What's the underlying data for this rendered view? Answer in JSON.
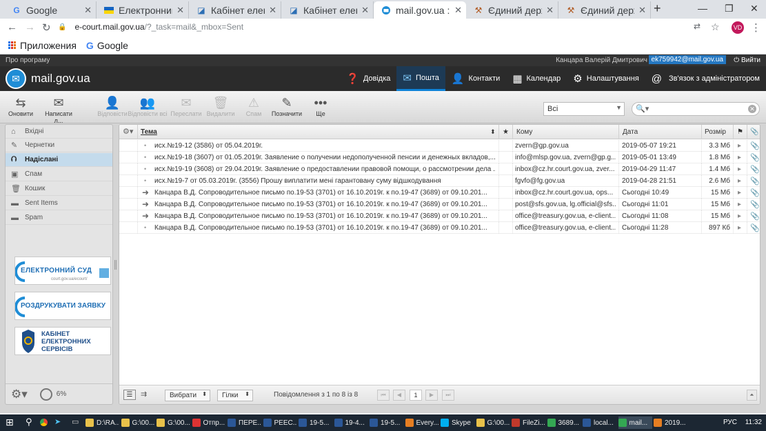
{
  "browser": {
    "tabs": [
      {
        "label": "Google",
        "favicon": "G",
        "color": "#4285f4"
      },
      {
        "label": "Електронний",
        "favicon": "flag",
        "color": "#ffd500"
      },
      {
        "label": "Кабінет елект",
        "favicon": "K",
        "color": "#2c6fb5"
      },
      {
        "label": "Кабінет елект",
        "favicon": "K",
        "color": "#2c6fb5"
      },
      {
        "label": "mail.gov.ua ::",
        "favicon": "@",
        "color": "#1f8dd6"
      },
      {
        "label": "Єдиний держ",
        "favicon": "hammer",
        "color": "#b05a22"
      },
      {
        "label": "Єдиний держ",
        "favicon": "hammer",
        "color": "#b05a22"
      }
    ],
    "url_host": "e-court.mail.gov.ua",
    "url_path": "/?_task=mail&_mbox=Sent",
    "profile_initials": "VD",
    "bookmarks": [
      {
        "label": "Приложения"
      },
      {
        "label": "Google"
      }
    ]
  },
  "app": {
    "about": "Про програму",
    "user_name": "Канцара Валерій Дмитрович",
    "user_email": "ek759942@mail.gov.ua",
    "logout": "Вийти",
    "logo_text": "mail.gov.ua",
    "nav": [
      {
        "label": "Довідка",
        "icon": "help-icon"
      },
      {
        "label": "Пошта",
        "icon": "mail-icon",
        "active": true
      },
      {
        "label": "Контакти",
        "icon": "contacts-icon"
      },
      {
        "label": "Календар",
        "icon": "calendar-icon"
      },
      {
        "label": "Налаштування",
        "icon": "gear-icon"
      },
      {
        "label": "Зв'язок з адміністратором",
        "icon": "at-icon"
      }
    ]
  },
  "toolbar": {
    "buttons": [
      {
        "label": "Оновити",
        "icon": "refresh-icon",
        "enabled": true
      },
      {
        "label": "Написати л...",
        "icon": "compose-icon",
        "enabled": true
      },
      {
        "label": "Відповісти",
        "icon": "reply-icon",
        "enabled": false
      },
      {
        "label": "Відповісти всі",
        "icon": "reply-all-icon",
        "enabled": false
      },
      {
        "label": "Переслати",
        "icon": "forward-icon",
        "enabled": false
      },
      {
        "label": "Видалити",
        "icon": "trash-icon",
        "enabled": false
      },
      {
        "label": "Спам",
        "icon": "spam-icon",
        "enabled": false
      },
      {
        "label": "Позначити",
        "icon": "mark-icon",
        "enabled": true
      },
      {
        "label": "Ще",
        "icon": "more-icon",
        "enabled": true
      }
    ],
    "filter_value": "Всі",
    "search_value": ""
  },
  "folders": [
    {
      "label": "Вхідні",
      "icon": "inbox-icon"
    },
    {
      "label": "Чернетки",
      "icon": "drafts-icon"
    },
    {
      "label": "Надіслані",
      "icon": "sent-icon",
      "selected": true
    },
    {
      "label": "Спам",
      "icon": "spam-icon"
    },
    {
      "label": "Кошик",
      "icon": "trash-icon"
    },
    {
      "label": "Sent Items",
      "icon": "folder-icon"
    },
    {
      "label": "Spam",
      "icon": "folder-icon"
    }
  ],
  "banners": [
    {
      "title": "ЕЛЕКТРОННИЙ СУД",
      "subtitle": "court.gov.ua/ecourt/"
    },
    {
      "title": "РОЗДРУКУВАТИ ЗАЯВКУ"
    },
    {
      "title": "КАБІНЕТ ЕЛЕКТРОННИХ СЕРВІСІВ"
    }
  ],
  "quota": "6%",
  "list": {
    "headers": {
      "subject": "Тема",
      "to": "Кому",
      "date": "Дата",
      "size": "Розмір"
    },
    "rows": [
      {
        "subject": "исх.№19-12 (3586) от 05.04.2019г.",
        "to": "zvern@gp.gov.ua",
        "date": "2019-05-07 19:21",
        "size": "3.3 Мб",
        "forwarded": false
      },
      {
        "subject": "исх.№19-18 (3607) от 01.05.2019г. Заявление о получении недополученной пенсии и денежных вкладов,...",
        "to": "info@mlsp.gov.ua, zvern@gp.g...",
        "date": "2019-05-01 13:49",
        "size": "1.8 Мб",
        "forwarded": false
      },
      {
        "subject": "исх.№19-19 (3608) от 29.04.2019г. Заявление о предоставлении правовой помощи, о рассмотрении дела ...",
        "to": "inbox@cz.hr.court.gov.ua, zver...",
        "date": "2019-04-29 11:47",
        "size": "1.4 Мб",
        "forwarded": false
      },
      {
        "subject": "исх.№19-7 от 05.03.2019г. (3556) Прошу виплатити мені гарантовану суму відшкодування",
        "to": "fgvfo@fg.gov.ua",
        "date": "2019-04-28 21:51",
        "size": "2.6 Мб",
        "forwarded": false
      },
      {
        "subject": "Канцара В.Д. Сопроводительное письмо по.19-53 (3701) от 16.10.2019г. к по.19-47 (3689) от 09.10.201...",
        "to": "inbox@cz.hr.court.gov.ua, ops...",
        "date": "Сьогодні 10:49",
        "size": "15 Мб",
        "forwarded": true
      },
      {
        "subject": "Канцара В.Д. Сопроводительное письмо по.19-53 (3701) от 16.10.2019г. к по.19-47 (3689) от 09.10.201...",
        "to": "post@sfs.gov.ua, lg.official@sfs...",
        "date": "Сьогодні 11:01",
        "size": "15 Мб",
        "forwarded": true
      },
      {
        "subject": "Канцара В.Д. Сопроводительное письмо по.19-53 (3701) от 16.10.2019г. к по.19-47 (3689) от 09.10.201...",
        "to": "office@treasury.gov.ua, e-client...",
        "date": "Сьогодні 11:08",
        "size": "15 Мб",
        "forwarded": true
      },
      {
        "subject": "Канцара В.Д. Сопроводительное письмо по.19-53 (3701) от 16.10.2019г. к по.19-47 (3689) от 09.10.201...",
        "to": "office@treasury.gov.ua, e-client...",
        "date": "Сьогодні 11:28",
        "size": "897 Кб",
        "forwarded": false
      }
    ],
    "footer": {
      "select_label": "Вибрати",
      "threads_label": "Гілки",
      "count_text": "Повідомлення з 1 по 8 із 8",
      "page": "1"
    }
  },
  "taskbar": {
    "items": [
      {
        "label": "D:\\RA...",
        "color": "#e8c14a"
      },
      {
        "label": "G:\\00...",
        "color": "#e8c14a"
      },
      {
        "label": "G:\\00...",
        "color": "#e8c14a"
      },
      {
        "label": "Отпр...",
        "color": "#d33"
      },
      {
        "label": "ПЕРЕ...",
        "color": "#2b5797"
      },
      {
        "label": "РЕЕС...",
        "color": "#2b5797"
      },
      {
        "label": "19-5...",
        "color": "#2b5797"
      },
      {
        "label": "19-4...",
        "color": "#2b5797"
      },
      {
        "label": "19-5...",
        "color": "#2b5797"
      },
      {
        "label": "Every...",
        "color": "#e67e22"
      },
      {
        "label": "Skype",
        "color": "#00aff0"
      },
      {
        "label": "G:\\00...",
        "color": "#e8c14a"
      },
      {
        "label": "FileZi...",
        "color": "#c0392b"
      },
      {
        "label": "3689...",
        "color": "#34a853"
      },
      {
        "label": "local...",
        "color": "#2b5797"
      },
      {
        "label": "mail...",
        "color": "#34a853",
        "active": true
      },
      {
        "label": "2019...",
        "color": "#e67e22"
      }
    ],
    "lang": "РУС",
    "time": "11:32"
  }
}
